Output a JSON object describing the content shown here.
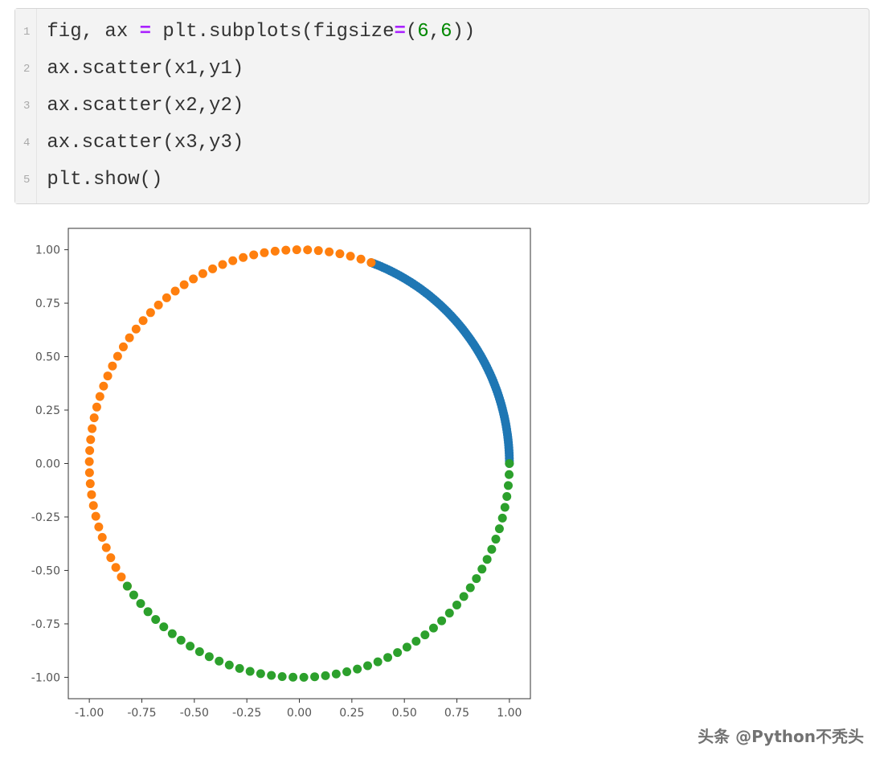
{
  "code": {
    "line_numbers": [
      "1",
      "2",
      "3",
      "4",
      "5"
    ],
    "lines": [
      {
        "tokens": [
          {
            "t": "fig, ax ",
            "c": "tok-name"
          },
          {
            "t": "=",
            "c": "tok-op"
          },
          {
            "t": " plt.subplots(figsize",
            "c": "tok-name"
          },
          {
            "t": "=",
            "c": "tok-op"
          },
          {
            "t": "(",
            "c": "tok-punc"
          },
          {
            "t": "6",
            "c": "tok-num"
          },
          {
            "t": ",",
            "c": "tok-punc"
          },
          {
            "t": "6",
            "c": "tok-num"
          },
          {
            "t": "))",
            "c": "tok-punc"
          }
        ]
      },
      {
        "tokens": [
          {
            "t": "ax.scatter(x1,y1)",
            "c": "tok-name"
          }
        ]
      },
      {
        "tokens": [
          {
            "t": "ax.scatter(x2,y2)",
            "c": "tok-name"
          }
        ]
      },
      {
        "tokens": [
          {
            "t": "ax.scatter(x3,y3)",
            "c": "tok-name"
          }
        ]
      },
      {
        "tokens": [
          {
            "t": "plt.show()",
            "c": "tok-name"
          }
        ]
      }
    ]
  },
  "chart_data": {
    "type": "scatter",
    "title": "",
    "xlabel": "",
    "ylabel": "",
    "xlim": [
      -1.1,
      1.1
    ],
    "ylim": [
      -1.1,
      1.1
    ],
    "xticks": [
      -1.0,
      -0.75,
      -0.5,
      -0.25,
      0.0,
      0.25,
      0.5,
      0.75,
      1.0
    ],
    "yticks": [
      -1.0,
      -0.75,
      -0.5,
      -0.25,
      0.0,
      0.25,
      0.5,
      0.75,
      1.0
    ],
    "series": [
      {
        "name": "x1,y1",
        "color": "#1f77b4",
        "angle_range_deg": [
          0,
          70
        ],
        "n_points": 100,
        "desc": "dense arc of unit circle from 0° to ~70°"
      },
      {
        "name": "x2,y2",
        "color": "#ff7f0e",
        "angle_range_deg": [
          70,
          215
        ],
        "n_points": 50,
        "desc": "arc of unit circle ~70° to ~215°"
      },
      {
        "name": "x3,y3",
        "color": "#2ca02c",
        "angle_range_deg": [
          215,
          360
        ],
        "n_points": 50,
        "desc": "arc of unit circle ~215° to 360°"
      }
    ],
    "note": "All points lie on the unit circle x=cos(θ), y=sin(θ)."
  },
  "watermark": "头条 @Python不秃头"
}
